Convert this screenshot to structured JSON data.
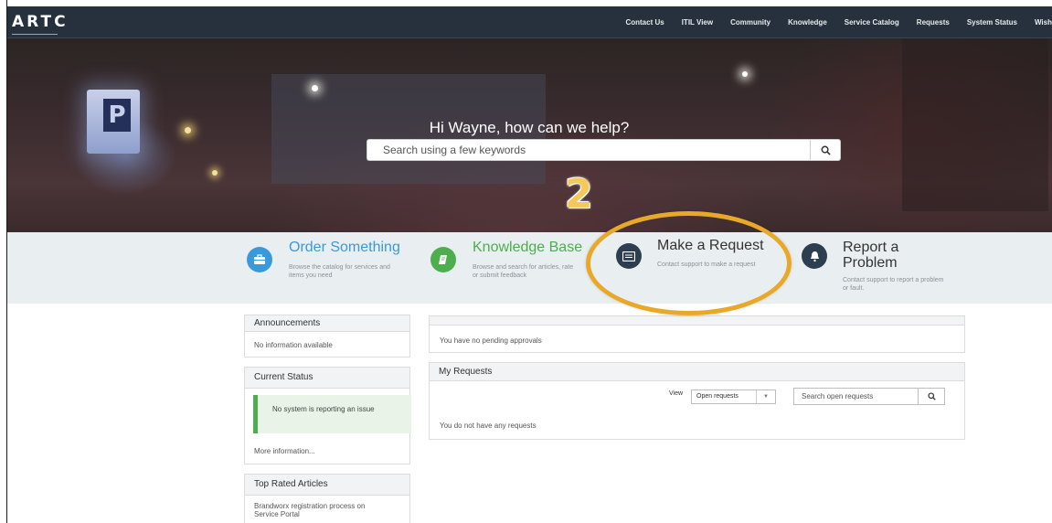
{
  "header": {
    "logo": "ARTC",
    "nav": [
      "Contact Us",
      "ITIL View",
      "Community",
      "Knowledge",
      "Service Catalog",
      "Requests",
      "System Status",
      "Wish"
    ]
  },
  "hero": {
    "greeting": "Hi Wayne, how can we help?",
    "search_placeholder": "Search using a few keywords",
    "annotation_step": "2"
  },
  "quicklinks": [
    {
      "title": "Order Something",
      "desc": "Browse the catalog for services and items you need",
      "color": "#3a9ad9",
      "icon": "briefcase-icon"
    },
    {
      "title": "Knowledge Base",
      "desc": "Browse and search for articles, rate or submit feedback",
      "color": "#4cae4c",
      "icon": "book-icon"
    },
    {
      "title": "Make a Request",
      "desc": "Contact support to make a request",
      "color": "#2c3e50",
      "icon": "list-icon"
    },
    {
      "title": "Report a Problem",
      "desc": "Contact support to report a problem or fault.",
      "color": "#2c3e50",
      "icon": "bell-icon"
    }
  ],
  "sidebar": {
    "announcements": {
      "title": "Announcements",
      "body": "No information available"
    },
    "current_status": {
      "title": "Current Status",
      "message": "No system is reporting an issue",
      "more": "More information..."
    },
    "top_articles": {
      "title": "Top Rated Articles",
      "items": [
        "Brandworx registration process on Service Portal"
      ]
    }
  },
  "main": {
    "approvals": "You have no pending approvals",
    "my_requests": {
      "title": "My Requests",
      "view_label": "View",
      "view_selected": "Open requests",
      "search_placeholder": "Search open requests",
      "empty": "You do not have any requests"
    }
  },
  "colors": {
    "nav_bg": "#26313d",
    "band_bg": "#e9eef1",
    "highlight": "#e8a82a",
    "link": "#2b74b7"
  }
}
